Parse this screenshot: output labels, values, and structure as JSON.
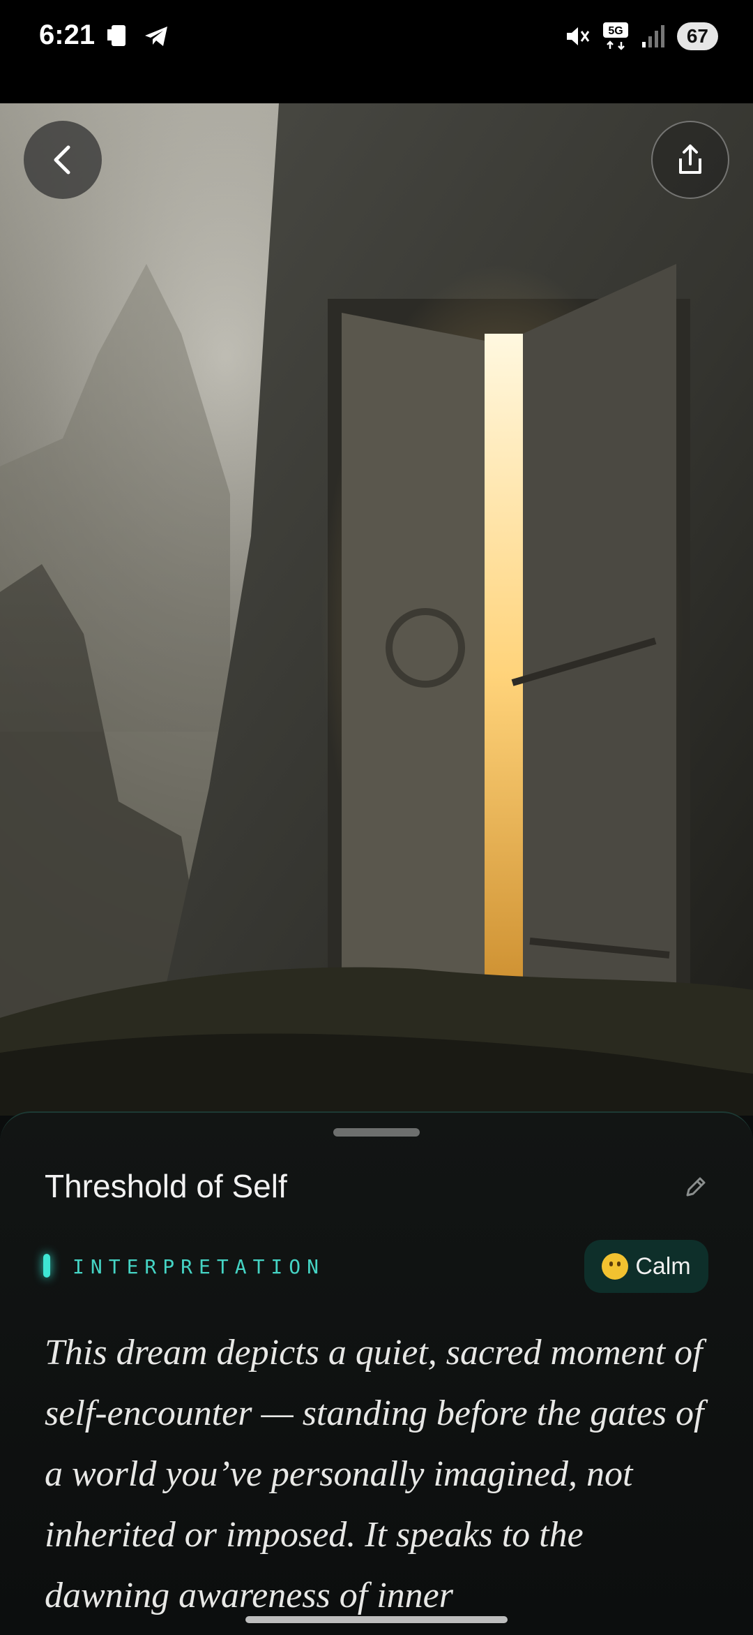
{
  "status_bar": {
    "time": "6:21",
    "battery": "67",
    "left_icons": [
      "phone-notification-icon",
      "telegram-icon"
    ],
    "right_icons": [
      "mute-icon",
      "5g-icon",
      "signal-icon"
    ]
  },
  "hero": {
    "back_icon": "chevron-left-icon",
    "share_icon": "share-icon"
  },
  "dream": {
    "title": "Threshold of Self",
    "section_label": "INTERPRETATION",
    "mood": "Calm",
    "interpretation": "This dream depicts a quiet, sacred moment of self-encounter — standing before the gates of a world you’ve personally imagined, not inherited or imposed. It speaks to the dawning awareness of inner"
  },
  "colors": {
    "accent": "#45d4c4",
    "badge_bg": "#0e2f2a",
    "sheet_bg": "#121514"
  }
}
